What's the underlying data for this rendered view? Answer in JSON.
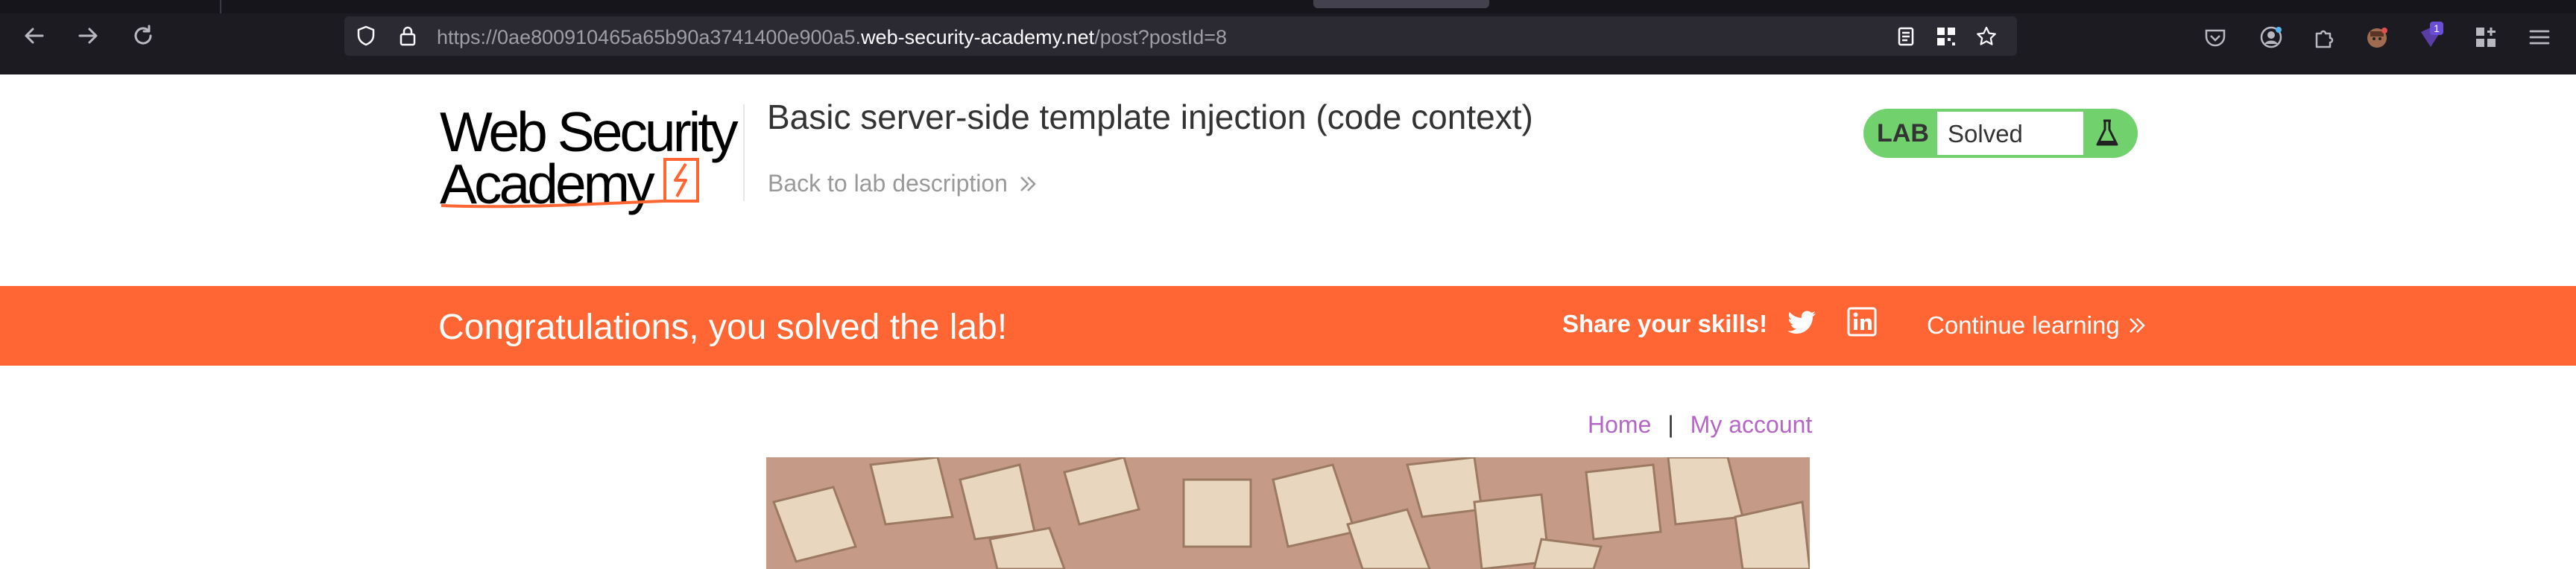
{
  "browser": {
    "url_prefix": "https://0ae800910465a65b90a3741400e900a5.",
    "url_host": "web-security-academy.net",
    "url_path": "/post?postId=8",
    "extension_badge": "1",
    "icons": [
      "back-arrow-icon",
      "forward-arrow-icon",
      "reload-icon",
      "shield-icon",
      "lock-icon",
      "reader-view-icon",
      "qr-code-icon",
      "bookmark-star-icon",
      "pocket-icon",
      "account-icon",
      "extensions-icon",
      "avatar-extension-icon",
      "badge-extension-icon",
      "grid-extension-icon",
      "menu-icon"
    ]
  },
  "header": {
    "logo_line1": "Web Security",
    "logo_line2": "Academy",
    "lab_title": "Basic server-side template injection (code context)",
    "back_link": "Back to lab description",
    "badge_label": "LAB",
    "badge_status": "Solved"
  },
  "banner": {
    "message": "Congratulations, you solved the lab!",
    "share": "Share your skills!",
    "continue": "Continue learning"
  },
  "nav": {
    "home": "Home",
    "separator": "|",
    "account": "My account"
  },
  "colors": {
    "brand_orange": "#ff6633",
    "lab_green": "#70d16d",
    "link_purple": "#b466c6",
    "chrome_bg": "#1c1b22"
  }
}
